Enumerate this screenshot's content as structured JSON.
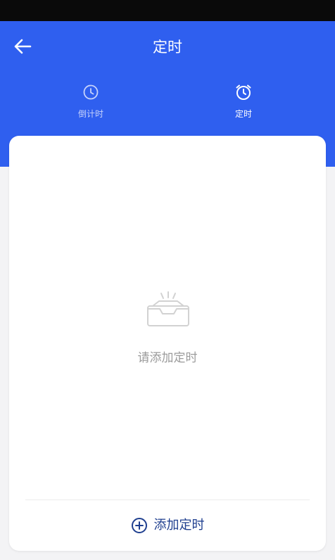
{
  "header": {
    "title": "定时",
    "back_icon": "arrow-left-icon",
    "background_color": "#2f5fef"
  },
  "tabs": [
    {
      "label": "倒计时",
      "icon": "clock-icon",
      "selected": false
    },
    {
      "label": "定时",
      "icon": "alarm-clock-icon",
      "selected": true
    }
  ],
  "empty_state": {
    "icon": "empty-inbox-icon",
    "message": "请添加定时"
  },
  "add_button": {
    "icon": "plus-circle-icon",
    "label": "添加定时",
    "color": "#1f3f8f"
  }
}
